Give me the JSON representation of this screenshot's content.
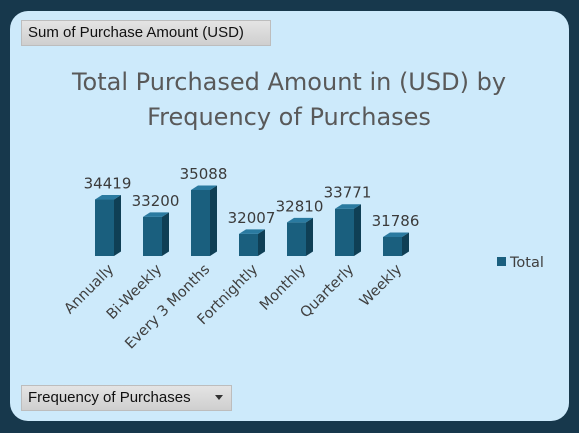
{
  "pivot": {
    "value_field": "Sum of Purchase Amount (USD)",
    "axis_field": "Frequency of Purchases"
  },
  "colors": {
    "background": "#cdeafb",
    "border": "#17384c",
    "bar_front": "#1a5f7e",
    "bar_side": "#0f3f55",
    "bar_top": "#2a7aa0"
  },
  "chart_data": {
    "type": "bar",
    "title_lines": [
      "Total Purchased Amount in (USD) by",
      "Frequency of Purchases"
    ],
    "categories": [
      "Annually",
      "Bi-Weekly",
      "Every 3 Months",
      "Fortnightly",
      "Monthly",
      "Quarterly",
      "Weekly"
    ],
    "series": [
      {
        "name": "Total",
        "values": [
          34419,
          33200,
          35088,
          32007,
          32810,
          33771,
          31786
        ]
      }
    ],
    "data_labels": true,
    "legend_position": "right",
    "ylim": [
      28000,
      36000
    ],
    "grid": false
  }
}
